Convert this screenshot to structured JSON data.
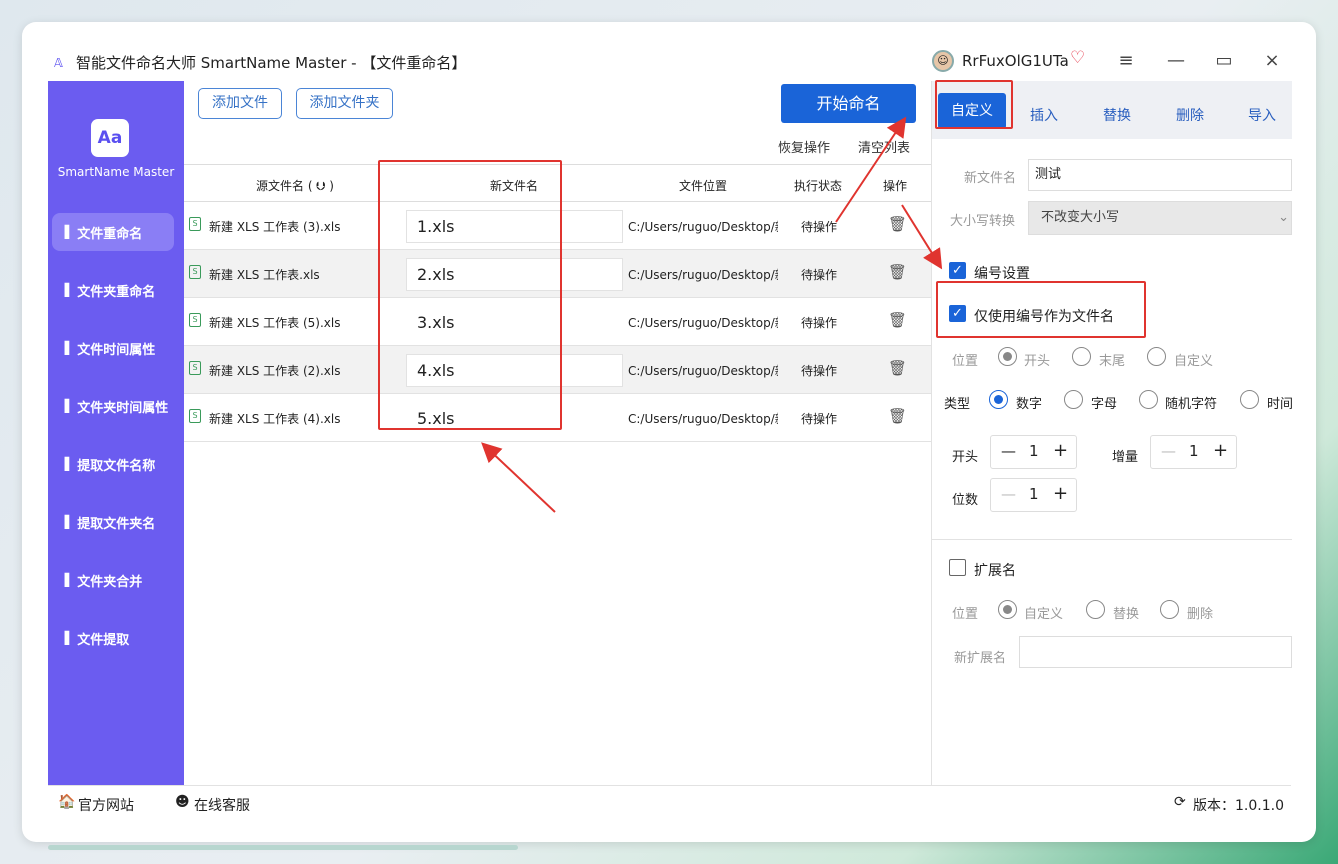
{
  "window": {
    "title": "智能文件命名大师 SmartName Master - 【文件重命名】",
    "username": "RrFuxOlG1UTa",
    "app_icon": "app-logo-icon",
    "vip_icon": "diamond-icon",
    "menu_glyph": "≡",
    "minimize_glyph": "—",
    "maximize_glyph": "▭",
    "close_glyph": "×"
  },
  "sidebar": {
    "logo_text": "SmartName Master",
    "logo_glyph": "Aa",
    "item_icon": "file-icon",
    "item_glyph": "▐",
    "items": [
      {
        "label": "文件重命名"
      },
      {
        "label": "文件夹重命名"
      },
      {
        "label": "文件时间属性"
      },
      {
        "label": "文件夹时间属性"
      },
      {
        "label": "提取文件名称"
      },
      {
        "label": "提取文件夹名"
      },
      {
        "label": "文件夹合并"
      },
      {
        "label": "文件提取"
      }
    ]
  },
  "toolbar": {
    "add_file": "添加文件",
    "add_folder": "添加文件夹",
    "start": "开始命名",
    "undo": "恢复操作",
    "clear": "清空列表"
  },
  "table": {
    "headers": [
      "源文件名 ( ⮋ )",
      "新文件名",
      "文件位置",
      "执行状态",
      "操作"
    ],
    "rows": [
      {
        "source": "新建 XLS 工作表 (3).xls",
        "new": "1.xls",
        "location": "C:/Users/ruguo/Desktop/新",
        "status": "待操作"
      },
      {
        "source": "新建 XLS 工作表.xls",
        "new": "2.xls",
        "location": "C:/Users/ruguo/Desktop/新",
        "status": "待操作"
      },
      {
        "source": "新建 XLS 工作表 (5).xls",
        "new": "3.xls",
        "location": "C:/Users/ruguo/Desktop/新",
        "status": "待操作"
      },
      {
        "source": "新建 XLS 工作表 (2).xls",
        "new": "4.xls",
        "location": "C:/Users/ruguo/Desktop/新",
        "status": "待操作"
      },
      {
        "source": "新建 XLS 工作表 (4).xls",
        "new": "5.xls",
        "location": "C:/Users/ruguo/Desktop/新",
        "status": "待操作"
      }
    ],
    "file_icon": "xls-file-icon",
    "file_glyph": "S",
    "trash_icon": "trash-icon",
    "trash_glyph": "🗑"
  },
  "panel": {
    "tabs": [
      "自定义",
      "插入",
      "替换",
      "删除",
      "导入"
    ],
    "new_name_label": "新文件名",
    "new_name_value": "测试",
    "case_label": "大小写转换",
    "case_value": "不改变大小写",
    "numbering_label": "编号设置",
    "numbering_checked": true,
    "only_number_label": "仅使用编号作为文件名",
    "only_number_checked": true,
    "position_label": "位置",
    "position_options": [
      "开头",
      "末尾",
      "自定义"
    ],
    "type_label": "类型",
    "type_options": [
      "数字",
      "字母",
      "随机字符",
      "时间"
    ],
    "start_label": "开头",
    "start_value": "1",
    "increment_label": "增量",
    "increment_value": "1",
    "digits_label": "位数",
    "digits_value": "1",
    "minus_glyph": "—",
    "plus_glyph": "+",
    "ext_label": "扩展名",
    "ext_checked": false,
    "ext_position_label": "位置",
    "ext_options": [
      "自定义",
      "替换",
      "删除"
    ],
    "new_ext_label": "新扩展名",
    "new_ext_value": "",
    "check_glyph": "✓",
    "dropdown_glyph": "⌄"
  },
  "footer": {
    "website": "官方网站",
    "support": "在线客服",
    "version": "版本：1.0.1.0",
    "home_glyph": "🏠",
    "support_glyph": "☻",
    "refresh_glyph": "⟳"
  },
  "colors": {
    "sidebar": "#6b5cf0",
    "primary": "#1a64d8",
    "annotation": "#e0342f"
  }
}
